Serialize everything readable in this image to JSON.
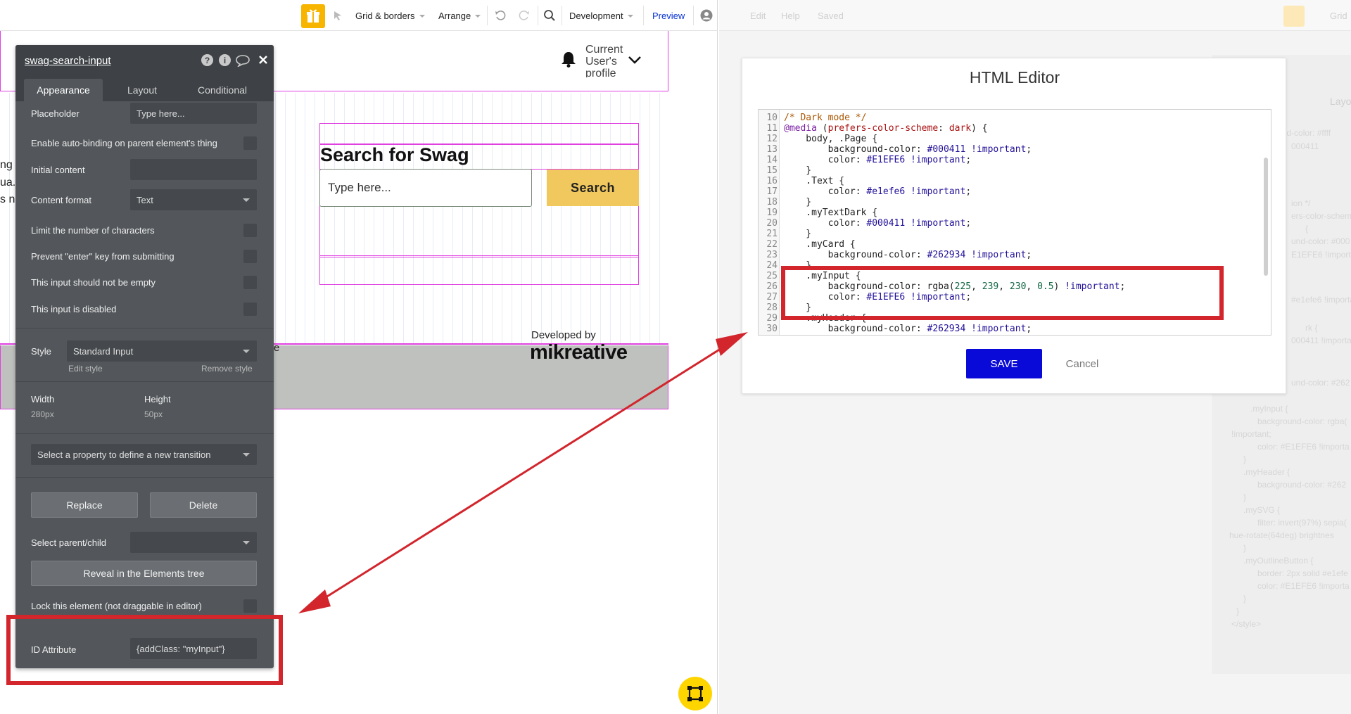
{
  "topbar": {
    "grid_borders": "Grid & borders",
    "arrange": "Arrange",
    "development": "Development",
    "preview": "Preview"
  },
  "canvas": {
    "search_title": "Search for Swag",
    "search_placeholder": "Type here...",
    "search_button": "Search",
    "profile_text": "Current User's profile",
    "developed_by": "Developed by",
    "brand": "mikreative",
    "cut_left_1": "ng",
    "cut_left_2": "ua.",
    "cut_left_3": "s ni",
    "cut_e": "e"
  },
  "panel": {
    "title": "swag-search-input",
    "tabs": [
      "Appearance",
      "Layout",
      "Conditional"
    ],
    "placeholder_label": "Placeholder",
    "placeholder_value": "Type here...",
    "autobinding_label": "Enable auto-binding on parent element's thing",
    "initial_content_label": "Initial content",
    "content_format_label": "Content format",
    "content_format_value": "Text",
    "limit_chars_label": "Limit the number of characters",
    "prevent_enter_label": "Prevent \"enter\" key from submitting",
    "not_empty_label": "This input should not be empty",
    "disabled_label": "This input is disabled",
    "style_label": "Style",
    "style_value": "Standard Input",
    "edit_style": "Edit style",
    "remove_style": "Remove style",
    "width_label": "Width",
    "width_value": "280px",
    "height_label": "Height",
    "height_value": "50px",
    "transition_select": "Select a property to define a new transition",
    "replace_btn": "Replace",
    "delete_btn": "Delete",
    "select_parent_label": "Select parent/child",
    "reveal_btn": "Reveal in the Elements tree",
    "lock_label": "Lock this element (not draggable in editor)",
    "id_attr_label": "ID Attribute",
    "id_attr_value": "{addClass: \"myInput\"}"
  },
  "right_ghost": {
    "edit": "Edit",
    "help": "Help",
    "saved": "Saved",
    "grid": "Grid",
    "layout": "Layou",
    "lines": [
      "und-color: #ffff",
      "000411",
      "",
      "",
      "ion */",
      "ers-color-schem",
      "{",
      "und-color: #000",
      "E1EFE6 !importa",
      "",
      "#e1efe6 !importa",
      "",
      "rk {",
      "000411 !importa",
      "",
      "und-color: #262",
      "",
      ".myInput {",
      "background-color: rgba(",
      "!important;",
      "color: #E1EFE6 !importa",
      "}",
      ".myHeader {",
      "background-color: #262",
      "}",
      ".mySVG {",
      "filter: invert(97%) sepia(",
      "hue-rotate(64deg) brightnes",
      "}",
      ".myOutlineButton {",
      "border: 2px solid #e1efe",
      "color: #E1EFE6 !importa",
      "}",
      "}",
      "</style>"
    ]
  },
  "editor": {
    "title": "HTML Editor",
    "save": "SAVE",
    "cancel": "Cancel",
    "line_numbers": [
      "10",
      "11",
      "12",
      "13",
      "14",
      "15",
      "16",
      "17",
      "18",
      "19",
      "20",
      "21",
      "22",
      "23",
      "24",
      "25",
      "26",
      "27",
      "28",
      "29",
      "30"
    ]
  },
  "colors": {
    "accent_yellow": "#f7b500",
    "highlight_red": "#d2252c",
    "save_blue": "#0a0ad8",
    "canvas_pink": "#e040e0",
    "search_button": "#f1c85e"
  },
  "icons": {
    "gift": "gift-icon",
    "cursor": "cursor-icon",
    "undo": "undo-icon",
    "redo": "redo-icon",
    "search": "search-icon",
    "user": "user-icon",
    "bell": "bell-icon",
    "chevron": "chevron-down-icon",
    "help": "help-icon",
    "info": "info-icon",
    "comment": "comment-icon",
    "close": "close-icon",
    "float": "element-tree-icon"
  }
}
